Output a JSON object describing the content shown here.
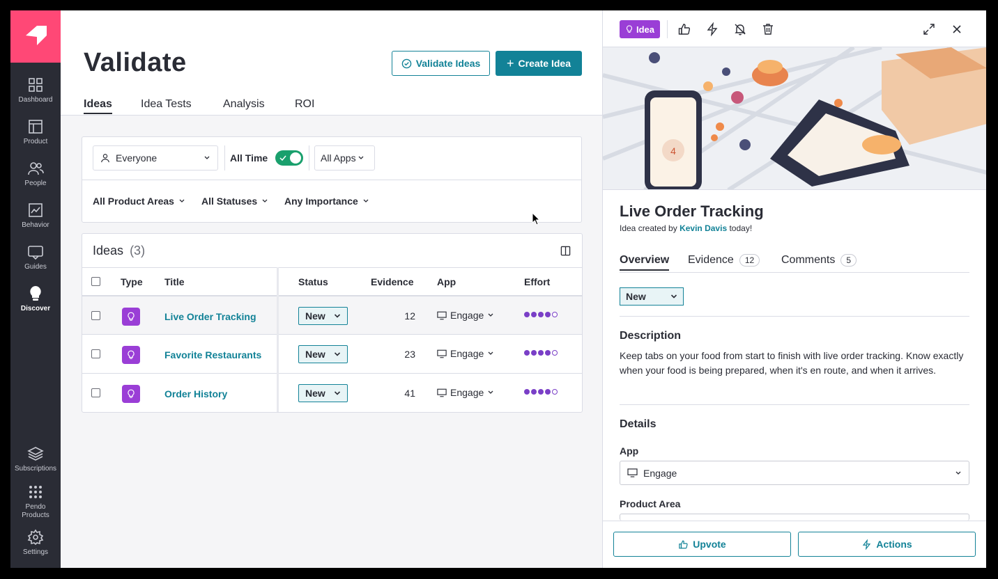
{
  "sidebar": {
    "items": [
      {
        "label": "Dashboard",
        "icon": "dashboard-icon"
      },
      {
        "label": "Product",
        "icon": "product-icon"
      },
      {
        "label": "People",
        "icon": "people-icon"
      },
      {
        "label": "Behavior",
        "icon": "behavior-icon"
      },
      {
        "label": "Guides",
        "icon": "guides-icon"
      },
      {
        "label": "Discover",
        "icon": "lightbulb-icon",
        "active": true
      },
      {
        "label": "Subscriptions",
        "icon": "layers-icon"
      },
      {
        "label": "Pendo Products",
        "icon": "grid-dots-icon"
      },
      {
        "label": "Settings",
        "icon": "gear-icon"
      }
    ]
  },
  "header": {
    "title": "Validate",
    "validate_button": "Validate Ideas",
    "create_button": "Create Idea",
    "tabs": [
      {
        "label": "Ideas",
        "active": true
      },
      {
        "label": "Idea Tests"
      },
      {
        "label": "Analysis"
      },
      {
        "label": "ROI"
      }
    ]
  },
  "filters": {
    "segment": "Everyone",
    "time_label": "All Time",
    "time_toggle_on": true,
    "apps": "All Apps",
    "product_areas": "All Product Areas",
    "statuses": "All Statuses",
    "importance": "Any Importance"
  },
  "table": {
    "title": "Ideas",
    "count": "(3)",
    "columns": [
      "Type",
      "Title",
      "Status",
      "Evidence",
      "App",
      "Effort"
    ],
    "rows": [
      {
        "title": "Live Order Tracking",
        "status": "New",
        "evidence": "12",
        "app": "Engage",
        "effort": 4
      },
      {
        "title": "Favorite Restaurants",
        "status": "New",
        "evidence": "23",
        "app": "Engage",
        "effort": 4
      },
      {
        "title": "Order History",
        "status": "New",
        "evidence": "41",
        "app": "Engage",
        "effort": 4
      }
    ]
  },
  "panel": {
    "badge": "Idea",
    "title": "Live Order Tracking",
    "created_prefix": "Idea created by",
    "created_by": "Kevin Davis",
    "created_suffix": "today!",
    "tabs": [
      {
        "label": "Overview",
        "active": true
      },
      {
        "label": "Evidence",
        "count": "12"
      },
      {
        "label": "Comments",
        "count": "5"
      }
    ],
    "status": "New",
    "description_heading": "Description",
    "description": "Keep tabs on your food from start to finish with live order tracking. Know exactly when your food is being prepared, when it's en route, and when it arrives.",
    "details_heading": "Details",
    "app_label": "App",
    "app_value": "Engage",
    "product_area_label": "Product Area",
    "upvote_button": "Upvote",
    "actions_button": "Actions"
  },
  "colors": {
    "accent": "#128297",
    "sidebar": "#2a2c35",
    "logo": "#ff4876",
    "idea_purple": "#9a3ed6",
    "toggle_green": "#1aa06d"
  }
}
